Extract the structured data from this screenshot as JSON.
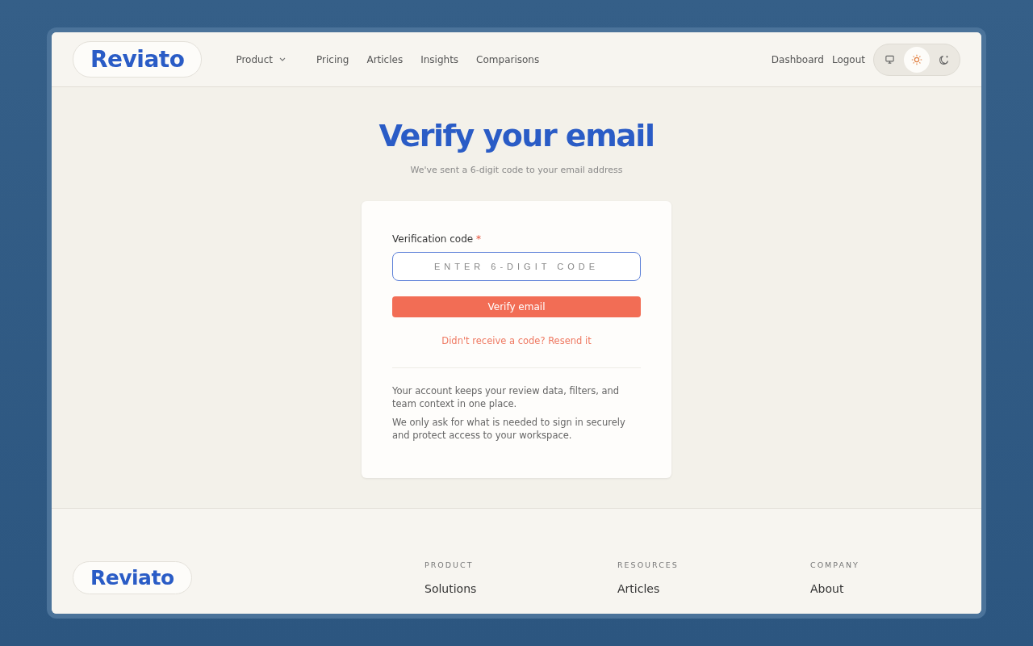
{
  "header": {
    "logo": "Reviato",
    "nav": [
      {
        "label": "Product",
        "dropdown": true
      },
      {
        "label": "Pricing",
        "dropdown": false
      },
      {
        "label": "Articles",
        "dropdown": false
      },
      {
        "label": "Insights",
        "dropdown": false
      },
      {
        "label": "Comparisons",
        "dropdown": false
      }
    ],
    "links": [
      "Dashboard",
      "Logout"
    ],
    "theme_options": [
      {
        "kind": "system",
        "selected": false
      },
      {
        "kind": "light",
        "selected": true
      },
      {
        "kind": "dark",
        "selected": false
      }
    ]
  },
  "page": {
    "title": "Verify your email",
    "subtitle": "We've sent a 6-digit code to your email address"
  },
  "form": {
    "label": "Verification code",
    "required_mark": "*",
    "placeholder": "ENTER 6-DIGIT CODE",
    "button": "Verify email",
    "resend": "Didn't receive a code? Resend it",
    "notes": [
      "Your account keeps your review data, filters, and team context in one place.",
      "We only ask for what is needed to sign in securely and protect access to your workspace."
    ]
  },
  "footer": {
    "logo": "Reviato",
    "columns": [
      {
        "heading": "PRODUCT",
        "links": [
          "Solutions"
        ]
      },
      {
        "heading": "RESOURCES",
        "links": [
          "Articles"
        ]
      },
      {
        "heading": "COMPANY",
        "links": [
          "About"
        ]
      }
    ]
  }
}
